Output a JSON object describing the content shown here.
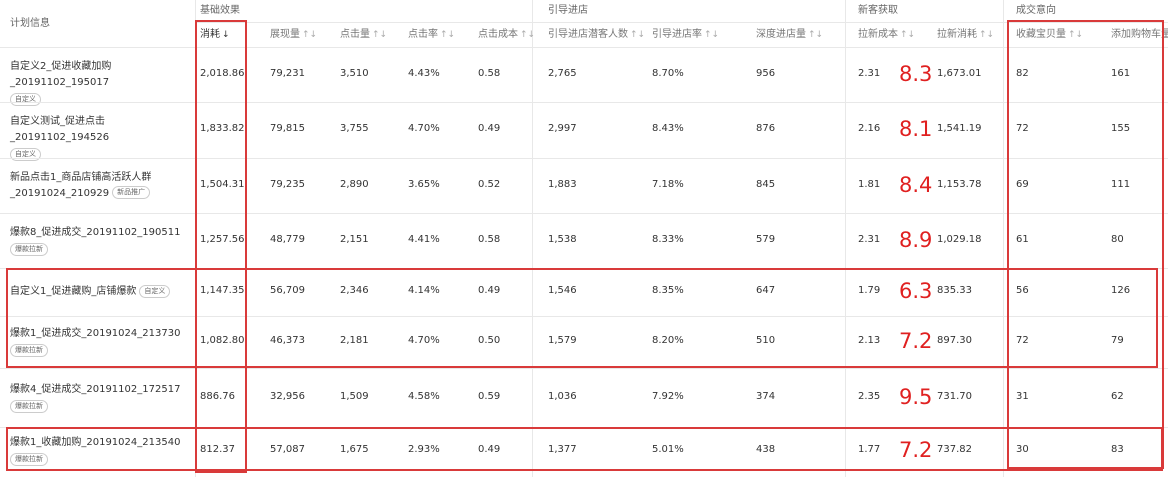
{
  "header": {
    "plan_info": "计划信息",
    "groups": {
      "basic": "基础效果",
      "guide": "引导进店",
      "newcust": "新客获取",
      "deal": "成交意向"
    },
    "cols": {
      "spend": "消耗",
      "impressions": "展现量",
      "clicks": "点击量",
      "ctr": "点击率",
      "cpc": "点击成本",
      "potential": "引导进店潜客人数",
      "guide_rate": "引导进店率",
      "deep": "深度进店量",
      "newcost": "拉新成本",
      "newspend": "拉新消耗",
      "fav": "收藏宝贝量",
      "cart": "添加购物车量"
    },
    "sort_active": "↓",
    "sort_idle": "↑↓"
  },
  "rows": [
    {
      "name": "自定义2_促进收藏加购_20191102_195017",
      "tag": "自定义",
      "spend": "2,018.86",
      "impressions": "79,231",
      "clicks": "3,510",
      "ctr": "4.43%",
      "cpc": "0.58",
      "potential": "2,765",
      "guide_rate": "8.70%",
      "deep": "956",
      "newcost": "2.31",
      "annot": "8.3",
      "newspend": "1,673.01",
      "fav": "82",
      "cart": "161"
    },
    {
      "name": "自定义测试_促进点击_20191102_194526",
      "tag": "自定义",
      "spend": "1,833.82",
      "impressions": "79,815",
      "clicks": "3,755",
      "ctr": "4.70%",
      "cpc": "0.49",
      "potential": "2,997",
      "guide_rate": "8.43%",
      "deep": "876",
      "newcost": "2.16",
      "annot": "8.1",
      "newspend": "1,541.19",
      "fav": "72",
      "cart": "155"
    },
    {
      "name": "新品点击1_商品店铺高活跃人群_20191024_210929",
      "tag": "新品推广",
      "spend": "1,504.31",
      "impressions": "79,235",
      "clicks": "2,890",
      "ctr": "3.65%",
      "cpc": "0.52",
      "potential": "1,883",
      "guide_rate": "7.18%",
      "deep": "845",
      "newcost": "1.81",
      "annot": "8.4",
      "newspend": "1,153.78",
      "fav": "69",
      "cart": "111"
    },
    {
      "name": "爆款8_促进成交_20191102_190511",
      "tag": "爆款拉新",
      "spend": "1,257.56",
      "impressions": "48,779",
      "clicks": "2,151",
      "ctr": "4.41%",
      "cpc": "0.58",
      "potential": "1,538",
      "guide_rate": "8.33%",
      "deep": "579",
      "newcost": "2.31",
      "annot": "8.9",
      "newspend": "1,029.18",
      "fav": "61",
      "cart": "80"
    },
    {
      "name": "自定义1_促进藏购_店铺爆款",
      "tag": "自定义",
      "spend": "1,147.35",
      "impressions": "56,709",
      "clicks": "2,346",
      "ctr": "4.14%",
      "cpc": "0.49",
      "potential": "1,546",
      "guide_rate": "8.35%",
      "deep": "647",
      "newcost": "1.79",
      "annot": "6.3",
      "newspend": "835.33",
      "fav": "56",
      "cart": "126"
    },
    {
      "name": "爆款1_促进成交_20191024_213730",
      "tag": "爆款拉新",
      "spend": "1,082.80",
      "impressions": "46,373",
      "clicks": "2,181",
      "ctr": "4.70%",
      "cpc": "0.50",
      "potential": "1,579",
      "guide_rate": "8.20%",
      "deep": "510",
      "newcost": "2.13",
      "annot": "7.2",
      "newspend": "897.30",
      "fav": "72",
      "cart": "79"
    },
    {
      "name": "爆款4_促进成交_20191102_172517",
      "tag": "爆款拉新",
      "spend": "886.76",
      "impressions": "32,956",
      "clicks": "1,509",
      "ctr": "4.58%",
      "cpc": "0.59",
      "potential": "1,036",
      "guide_rate": "7.92%",
      "deep": "374",
      "newcost": "2.35",
      "annot": "9.5",
      "newspend": "731.70",
      "fav": "31",
      "cart": "62"
    },
    {
      "name": "爆款1_收藏加购_20191024_213540",
      "tag": "爆款拉新",
      "spend": "812.37",
      "impressions": "57,087",
      "clicks": "1,675",
      "ctr": "2.93%",
      "cpc": "0.49",
      "potential": "1,377",
      "guide_rate": "5.01%",
      "deep": "438",
      "newcost": "1.77",
      "annot": "7.2",
      "newspend": "737.82",
      "fav": "30",
      "cart": "83"
    }
  ]
}
